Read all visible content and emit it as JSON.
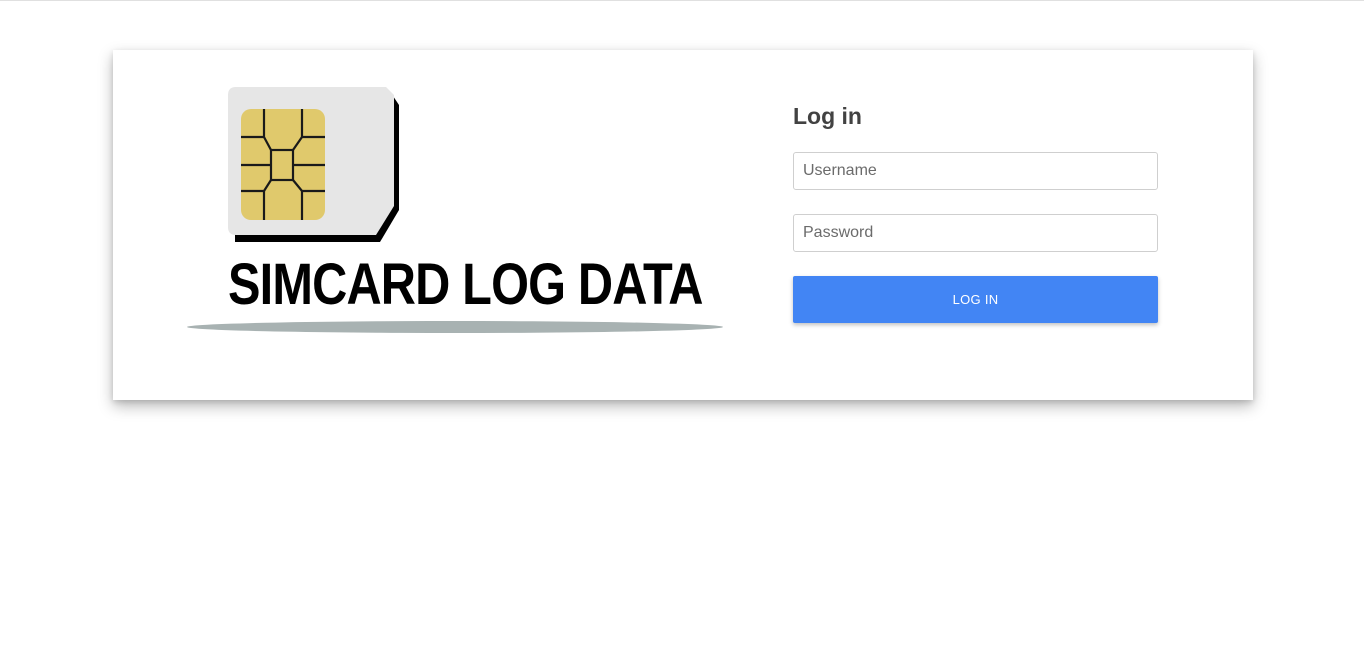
{
  "logo": {
    "text": "SIMCARD LOG DATA",
    "icon": "simcard-icon",
    "colors": {
      "card": "#e6e6e6",
      "chip": "#e0c96c",
      "shadow": "#a8b2b2"
    }
  },
  "login": {
    "title": "Log in",
    "username_placeholder": "Username",
    "username_value": "",
    "password_placeholder": "Password",
    "password_value": "",
    "button_label": "LOG IN",
    "accent_color": "#4285f4"
  }
}
